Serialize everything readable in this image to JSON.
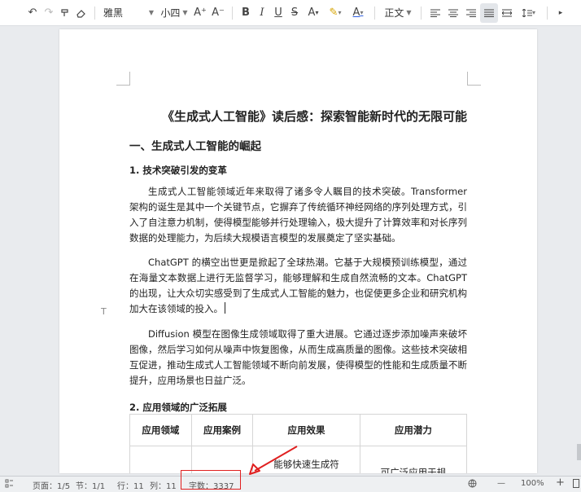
{
  "toolbar": {
    "font_name": "雅黑",
    "font_size": "小四",
    "style_name": "正文",
    "icons": [
      "undo-icon",
      "redo-icon",
      "format-painter-icon",
      "eraser-icon",
      "increase-font-icon",
      "decrease-font-icon",
      "bold-icon",
      "italic-icon",
      "underline-icon",
      "strikethrough-icon",
      "superscript-icon",
      "highlight-icon",
      "font-color-icon",
      "align-left-icon",
      "align-center-icon",
      "align-right-icon",
      "justify-icon",
      "distributed-icon",
      "line-spacing-icon",
      "more-icon"
    ],
    "glyphs": {
      "undo": "↶",
      "redo": "↷",
      "painter": "🖌",
      "eraser": "⌫",
      "grow": "A⁺",
      "shrink": "A⁻",
      "bold": "B",
      "italic": "I",
      "underline": "U",
      "strike": "S̶",
      "superscript": "A",
      "highlight": "✎",
      "fontcolor": "A",
      "more": "▸"
    }
  },
  "document": {
    "title": "《生成式人工智能》读后感：探索智能新时代的无限可能",
    "section1": "一、生成式人工智能的崛起",
    "sub1": "1.  技术突破引发的变革",
    "p1": "生成式人工智能领域近年来取得了诸多令人瞩目的技术突破。Transformer 架构的诞生是其中一个关键节点，它摒弃了传统循环神经网络的序列处理方式，引入了自注意力机制，使得模型能够并行处理输入，极大提升了计算效率和对长序列数据的处理能力，为后续大规模语言模型的发展奠定了坚实基础。",
    "p2": "ChatGPT 的横空出世更是掀起了全球热潮。它基于大规模预训练模型，通过在海量文本数据上进行无监督学习，能够理解和生成自然流畅的文本。ChatGPT 的出现，让大众切实感受到了生成式人工智能的魅力，也促使更多企业和研究机构加大在该领域的投入。",
    "p3": "Diffusion 模型在图像生成领域取得了重大进展。它通过逐步添加噪声来破坏图像，然后学习如何从噪声中恢复图像，从而生成高质量的图像。这些技术突破相互促进，推动生成式人工智能领域不断向前发展，使得模型的性能和生成质量不断提升，应用场景也日益广泛。",
    "sub2": "2.  应用领域的广泛拓展",
    "side_mark": "T",
    "table": {
      "headers": [
        "应用领域",
        "应用案例",
        "应用效果",
        "应用潜力"
      ],
      "row1": [
        "",
        "",
        "能够快速生成符",
        "可广泛应用于规"
      ]
    }
  },
  "statusbar": {
    "page": "页面：1/5",
    "section": "节：1/1",
    "row": "行：11",
    "col": "列：11",
    "wordcount": "字数：3337",
    "zoom": "100%",
    "minus": "—",
    "plus": "+"
  },
  "colors": {
    "annotation_red": "#e02020"
  }
}
